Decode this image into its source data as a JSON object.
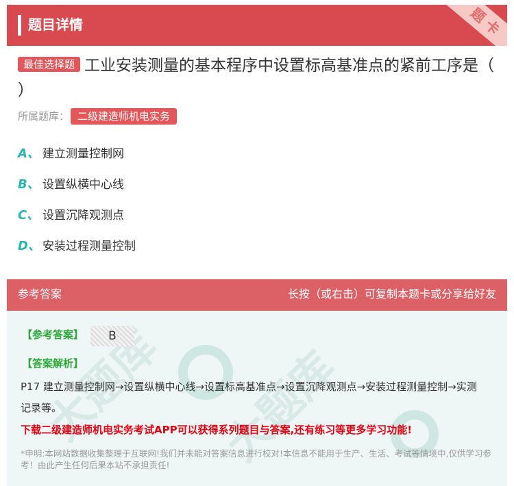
{
  "header": {
    "title": "题目详情",
    "corner_label_1": "题",
    "corner_label_2": "卡"
  },
  "question": {
    "type_badge": "最佳选择题",
    "text": "工业安装测量的基本程序中设置标高基准点的紧前工序是（   ）",
    "source_label": "所属题库：",
    "source_value": "二级建造师机电实务"
  },
  "options": [
    {
      "letter": "A、",
      "text": "建立测量控制网"
    },
    {
      "letter": "B、",
      "text": "设置纵横中心线"
    },
    {
      "letter": "C、",
      "text": "设置沉降观测点"
    },
    {
      "letter": "D、",
      "text": "安装过程测量控制"
    }
  ],
  "answer": {
    "head_left": "参考答案",
    "head_right": "长按（或右击）可复制本题卡或分享给好友",
    "ref_label": "【参考答案】",
    "ref_value": "B",
    "analysis_label": "【答案解析】",
    "analysis_text": "P17 建立测量控制网→设置纵横中心线→设置标高基准点→设置沉降观测点→安装过程测量控制→实测记录等。",
    "promo": "下载二级建造师机电实务考试APP可以获得系列题目与答案,还有练习等更多学习功能!",
    "disclaimer": "*申明:本网站数据收集整理于互联网!我们并未能对答案信息进行校对!本信息不能用于生产、生活、考试等情境中,仅供学习参考！由此产生任何后果本站不承担责任!",
    "watermark": "大题库"
  },
  "colors": {
    "header_bg": "#d84a4f",
    "answer_head_bg": "#dc6167",
    "accent_teal": "#2ab5b0",
    "label_green": "#2fa63a",
    "promo_red": "#e60012"
  }
}
